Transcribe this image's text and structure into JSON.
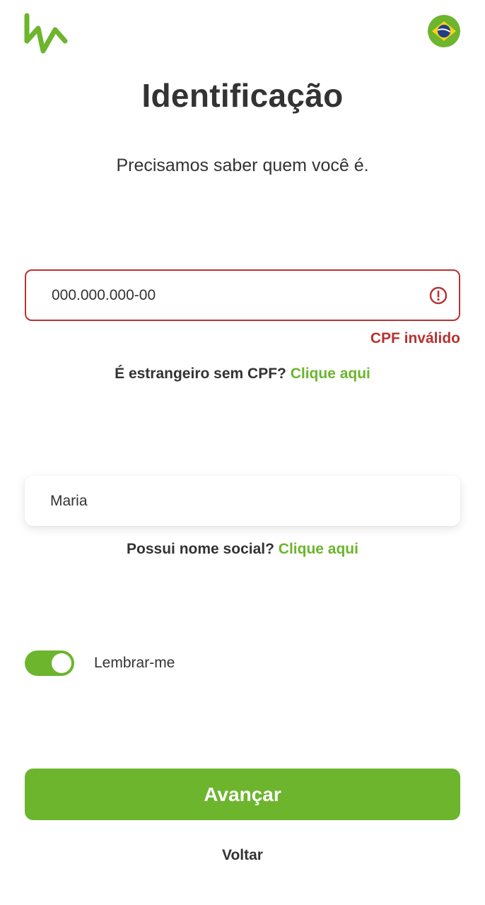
{
  "header": {
    "logo_icon": "ka-logo",
    "language_icon": "brazil-flag-icon"
  },
  "page": {
    "title": "Identificação",
    "subtitle": "Precisamos saber quem você é."
  },
  "cpf": {
    "value": "000.000.000-00",
    "error_icon": "exclamation-circle-icon",
    "error_text": "CPF inválido",
    "helper_text": "É estrangeiro sem CPF?",
    "helper_link": "Clique aqui"
  },
  "name": {
    "value": "Maria",
    "helper_text": "Possui nome social?",
    "helper_link": "Clique aqui"
  },
  "remember": {
    "label": "Lembrar-me",
    "enabled": true
  },
  "actions": {
    "primary": "Avançar",
    "back": "Voltar"
  },
  "colors": {
    "brand_green": "#6cb52d",
    "error_red": "#b83232",
    "text": "#333333"
  }
}
